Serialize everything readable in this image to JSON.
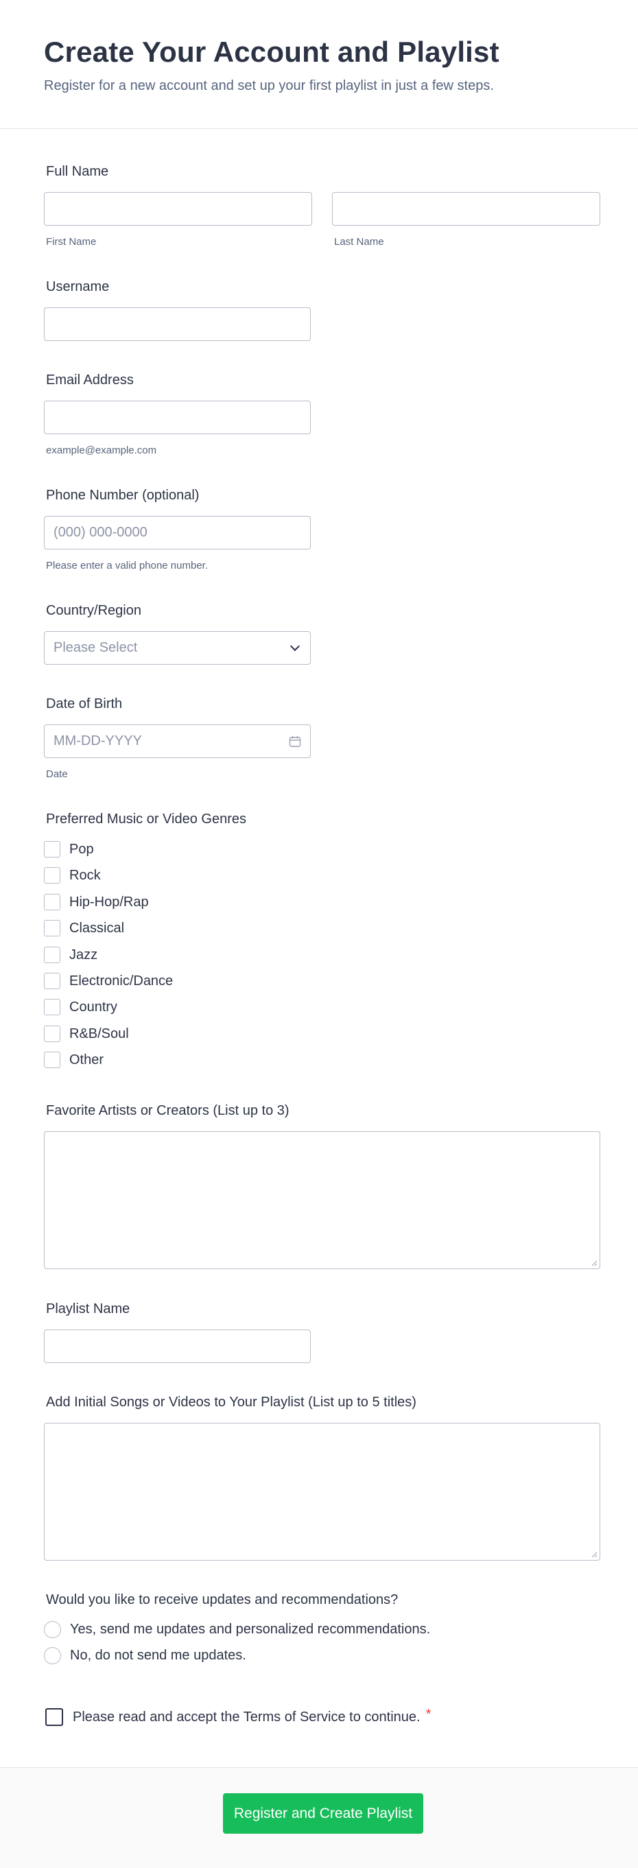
{
  "header": {
    "title": "Create Your Account and Playlist",
    "subtitle": "Register for a new account and set up your first playlist in just a few steps."
  },
  "full_name": {
    "label": "Full Name",
    "first_sublabel": "First Name",
    "last_sublabel": "Last Name",
    "first_value": "",
    "last_value": ""
  },
  "username": {
    "label": "Username",
    "value": ""
  },
  "email": {
    "label": "Email Address",
    "value": "",
    "sublabel": "example@example.com"
  },
  "phone": {
    "label": "Phone Number (optional)",
    "placeholder": "(000) 000-0000",
    "sublabel": "Please enter a valid phone number."
  },
  "country": {
    "label": "Country/Region",
    "placeholder": "Please Select"
  },
  "dob": {
    "label": "Date of Birth",
    "placeholder": "MM-DD-YYYY",
    "sublabel": "Date"
  },
  "genres": {
    "label": "Preferred Music or Video Genres",
    "options": [
      "Pop",
      "Rock",
      "Hip-Hop/Rap",
      "Classical",
      "Jazz",
      "Electronic/Dance",
      "Country",
      "R&B/Soul",
      "Other"
    ]
  },
  "artists": {
    "label": "Favorite Artists or Creators (List up to 3)"
  },
  "playlist_name": {
    "label": "Playlist Name",
    "value": ""
  },
  "initial_items": {
    "label": "Add Initial Songs or Videos to Your Playlist (List up to 5 titles)"
  },
  "updates": {
    "label": "Would you like to receive updates and recommendations?",
    "options": [
      "Yes, send me updates and personalized recommendations.",
      "No, do not send me updates."
    ]
  },
  "terms": {
    "label": "Please read and accept the Terms of Service to continue.",
    "required_mark": "*"
  },
  "submit": {
    "label": "Register and Create Playlist"
  },
  "colors": {
    "accent": "#18bd5b",
    "required": "#f23a3c",
    "text": "#2c3345",
    "border": "#b8bdc9"
  }
}
